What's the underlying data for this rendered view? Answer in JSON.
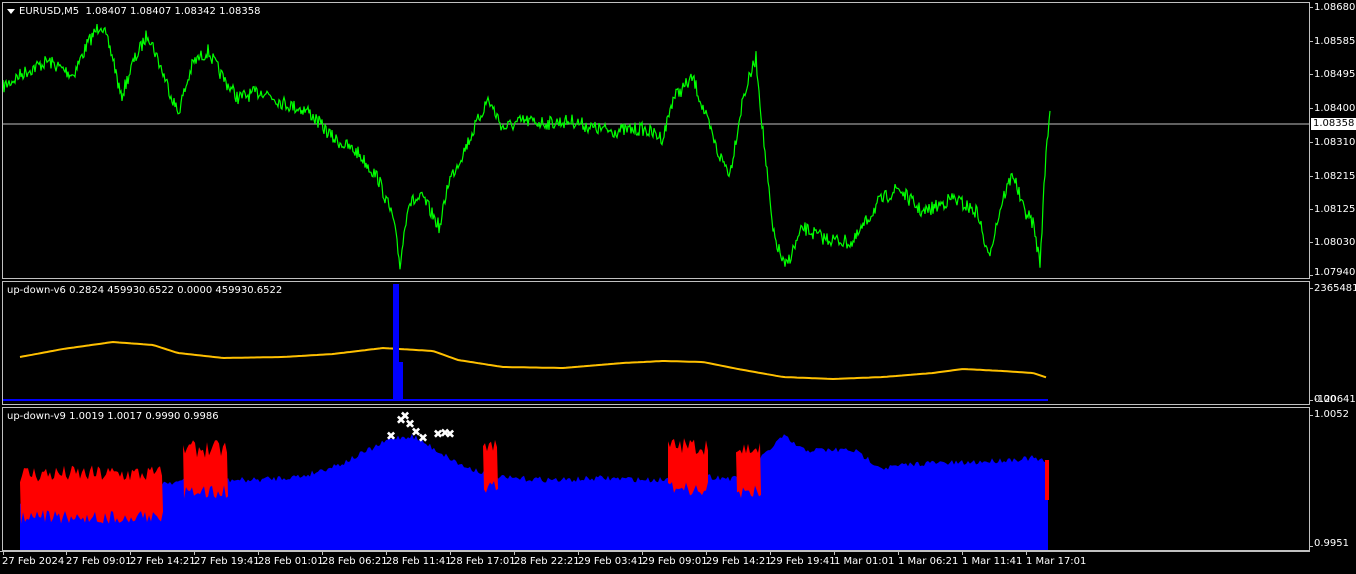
{
  "main": {
    "symbol": "EURUSD,M5",
    "ohlc": "1.08407 1.08407 1.08342 1.08358",
    "current_price": "1.08358",
    "price_ticks": [
      "1.08680",
      "1.08585",
      "1.08495",
      "1.08400",
      "1.08310",
      "1.08215",
      "1.08125",
      "1.08030",
      "1.07940"
    ],
    "line_color": "#00ff00"
  },
  "ind1": {
    "label": "up-down-v6 0.2824 459930.6522 0.0000 459930.6522",
    "scale_top": "2365481.9",
    "scale_bottom_a": "0.00",
    "scale_bottom_b": "0.00",
    "scale_bottom_c": "-120641.9",
    "ma_color": "#ffc000",
    "bar_color": "#0000ff"
  },
  "ind2": {
    "label": "up-down-v9 1.0019 1.0017 0.9990 0.9986",
    "scale_top": "1.0052",
    "scale_bottom": "0.9951",
    "blue": "#0000ff",
    "red": "#ff0000"
  },
  "time_labels": [
    "27 Feb 2024",
    "27 Feb 09:01",
    "27 Feb 14:21",
    "27 Feb 19:41",
    "28 Feb 01:01",
    "28 Feb 06:21",
    "28 Feb 11:41",
    "28 Feb 17:01",
    "28 Feb 22:21",
    "29 Feb 03:41",
    "29 Feb 09:01",
    "29 Feb 14:21",
    "29 Feb 19:41",
    "1 Mar 01:01",
    "1 Mar 06:21",
    "1 Mar 11:41",
    "1 Mar 17:01"
  ]
}
